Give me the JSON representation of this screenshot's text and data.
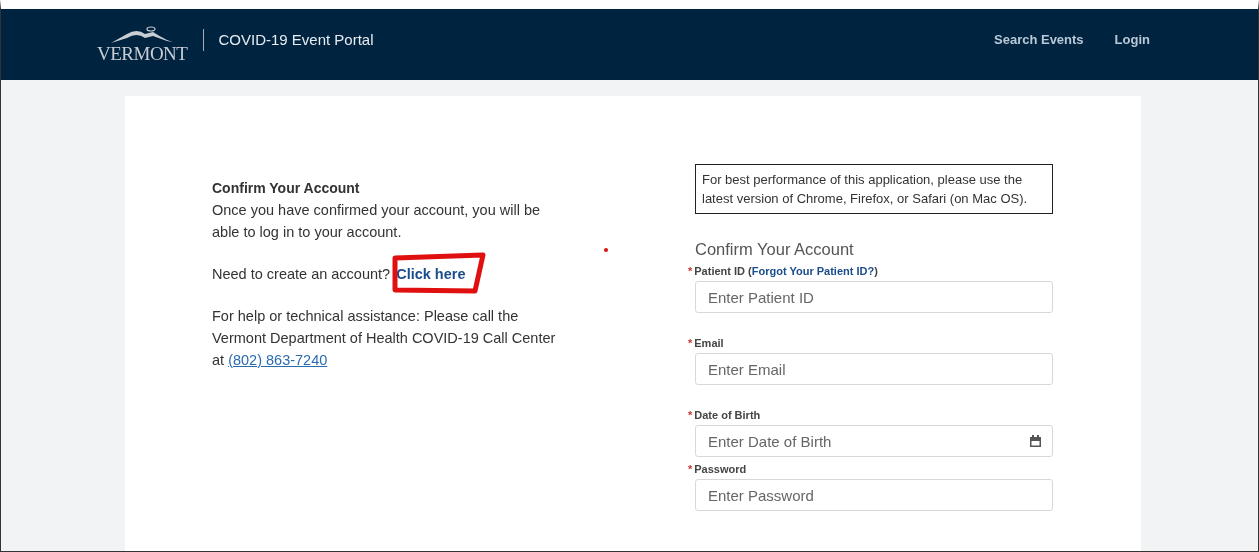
{
  "header": {
    "logo": "VERMONT",
    "title": "COVID-19 Event Portal",
    "nav": [
      "Search Events",
      "Login"
    ]
  },
  "info": {
    "heading": "Confirm Your Account",
    "body": "Once you have confirmed your account, you will be able to log in to your account.",
    "create_prompt": "Need to create an account?",
    "create_link": "Click here",
    "help_text": "For help or technical assistance: Please call the Vermont Department of Health COVID-19 Call Center at",
    "phone": "(802) 863-7240"
  },
  "notice": "For best performance of this application, please use the latest version of Chrome, Firefox, or Safari (on Mac OS).",
  "form": {
    "title": "Confirm Your Account",
    "fields": [
      {
        "kind": "text",
        "required": "*",
        "label": "Patient ID",
        "link_open": "(",
        "link": "Forgot Your Patient ID?",
        "link_close": ")",
        "placeholder": "Enter Patient ID"
      },
      {
        "kind": "text",
        "required": "*",
        "label": "Email",
        "placeholder": "Enter Email"
      },
      {
        "kind": "date",
        "required": "*",
        "label": "Date of Birth",
        "placeholder": "Enter Date of Birth"
      },
      {
        "kind": "text",
        "required": "*",
        "label": "Password",
        "placeholder": "Enter Password"
      }
    ]
  }
}
